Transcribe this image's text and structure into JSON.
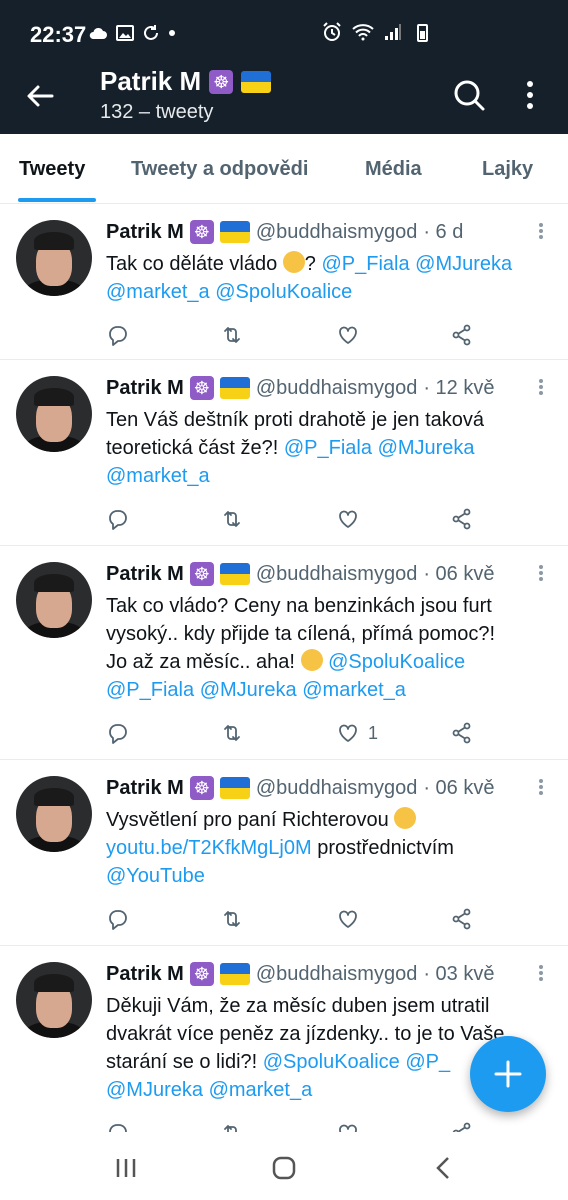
{
  "status_bar": {
    "time": "22:37",
    "left_icons": [
      "cloud-icon",
      "image-icon",
      "sync-icon",
      "dot-icon"
    ],
    "right_icons": [
      "alarm-icon",
      "wifi-icon",
      "signal-icon",
      "battery-icon"
    ]
  },
  "header": {
    "name": "Patrik M",
    "badges": [
      "dharma-wheel-icon",
      "ukraine-flag-icon"
    ],
    "subtitle": "132 – tweety"
  },
  "tabs": [
    {
      "label": "Tweety",
      "active": true
    },
    {
      "label": "Tweety a odpovědi",
      "active": false
    },
    {
      "label": "Média",
      "active": false
    },
    {
      "label": "Lajky",
      "active": false
    }
  ],
  "tweets": [
    {
      "name": "Patrik M",
      "handle": "@buddhaismygod",
      "time": "· 6 d",
      "lines": [
        [
          {
            "t": "Tak co děláte vládo ",
            "m": false
          },
          {
            "emoji": "drooling-face"
          },
          {
            "t": "? ",
            "m": false
          },
          {
            "t": "@P_Fiala",
            "m": true
          },
          {
            "t": " ",
            "m": false
          },
          {
            "t": "@MJureka",
            "m": true
          }
        ],
        [
          {
            "t": "@market_a",
            "m": true
          },
          {
            "t": " ",
            "m": false
          },
          {
            "t": "@SpoluKoalice",
            "m": true
          }
        ]
      ],
      "likes": ""
    },
    {
      "name": "Patrik M",
      "handle": "@buddhaismygod",
      "time": "· 12 kvě",
      "lines": [
        [
          {
            "t": "Ten Váš deštník proti drahotě je jen taková",
            "m": false
          }
        ],
        [
          {
            "t": "teoretická část že?! ",
            "m": false
          },
          {
            "t": "@P_Fiala",
            "m": true
          },
          {
            "t": " ",
            "m": false
          },
          {
            "t": "@MJureka",
            "m": true
          }
        ],
        [
          {
            "t": "@market_a",
            "m": true
          }
        ]
      ],
      "likes": ""
    },
    {
      "name": "Patrik M",
      "handle": "@buddhaismygod",
      "time": "· 06 kvě",
      "lines": [
        [
          {
            "t": "Tak co vládo? Ceny na benzinkách jsou furt",
            "m": false
          }
        ],
        [
          {
            "t": "vysoký.. kdy přijde ta cílená, přímá pomoc?!",
            "m": false
          }
        ],
        [
          {
            "t": "Jo až za měsíc.. aha! ",
            "m": false
          },
          {
            "emoji": "expressionless-face"
          },
          {
            "t": " ",
            "m": false
          },
          {
            "t": "@SpoluKoalice",
            "m": true
          }
        ],
        [
          {
            "t": "@P_Fiala",
            "m": true
          },
          {
            "t": " ",
            "m": false
          },
          {
            "t": "@MJureka",
            "m": true
          },
          {
            "t": " ",
            "m": false
          },
          {
            "t": "@market_a",
            "m": true
          }
        ]
      ],
      "likes": "1"
    },
    {
      "name": "Patrik M",
      "handle": "@buddhaismygod",
      "time": "· 06 kvě",
      "lines": [
        [
          {
            "t": "Vysvětlení pro paní Richterovou ",
            "m": false
          },
          {
            "emoji": "thumbs-up"
          }
        ],
        [
          {
            "t": "youtu.be/T2KfkMgLj0M",
            "m": true
          },
          {
            "t": " prostřednictvím",
            "m": false
          }
        ],
        [
          {
            "t": "@YouTube",
            "m": true
          }
        ]
      ],
      "likes": ""
    },
    {
      "name": "Patrik M",
      "handle": "@buddhaismygod",
      "time": "· 03 kvě",
      "lines": [
        [
          {
            "t": "Děkuji Vám, že za měsíc duben jsem utratil",
            "m": false
          }
        ],
        [
          {
            "t": "dvakrát více peněz za jízdenky.. to je to Vaše",
            "m": false
          }
        ],
        [
          {
            "t": "starání se o lidi?! ",
            "m": false
          },
          {
            "t": "@SpoluKoalice",
            "m": true
          },
          {
            "t": " ",
            "m": false
          },
          {
            "t": "@P_",
            "m": true
          }
        ],
        [
          {
            "t": "@MJureka",
            "m": true
          },
          {
            "t": " ",
            "m": false
          },
          {
            "t": "@market_a",
            "m": true
          }
        ]
      ],
      "likes": ""
    }
  ],
  "fab": {
    "icon": "compose-plus-icon"
  },
  "colors": {
    "accent": "#1d9bf0",
    "header_bg": "#15202b",
    "muted": "#536471"
  }
}
